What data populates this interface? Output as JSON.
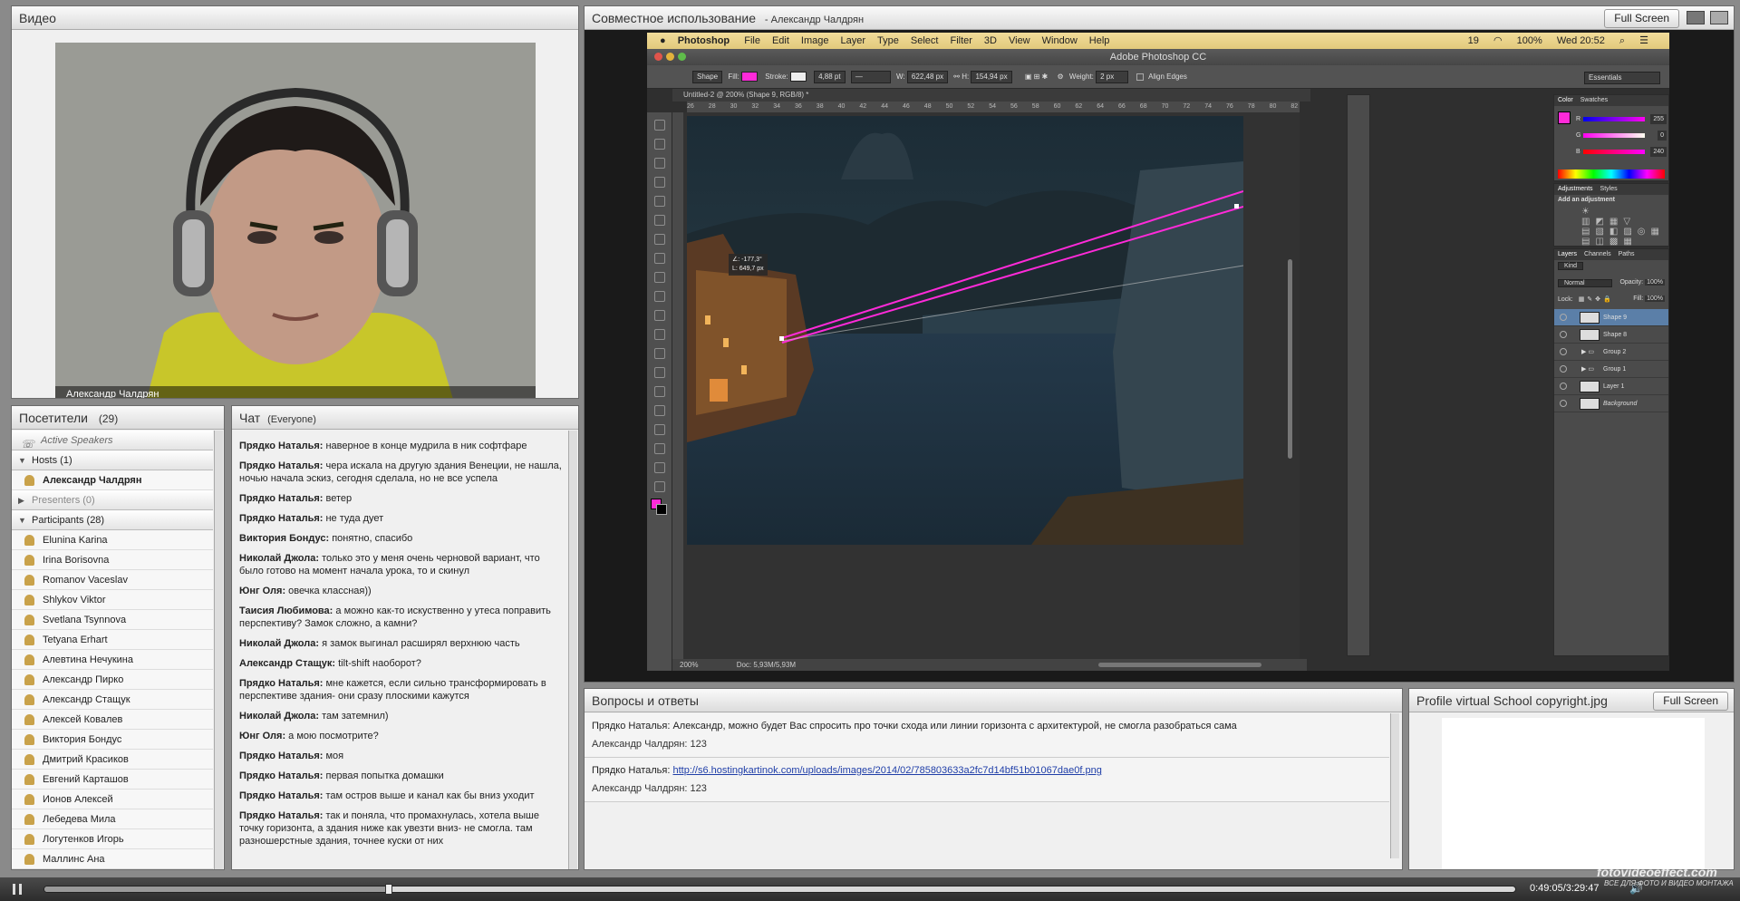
{
  "video_pod": {
    "title": "Видео",
    "speaker_name": "Александр Чалдрян"
  },
  "share_pod": {
    "title": "Совместное использование",
    "presenter": "- Александр Чалдрян",
    "fullscreen_label": "Full Screen"
  },
  "attendees": {
    "title": "Посетители",
    "count": "(29)",
    "active_speakers": "Active Speakers",
    "hosts_label": "Hosts (1)",
    "hosts": [
      "Александр Чалдрян"
    ],
    "presenters_label": "Presenters (0)",
    "participants_label": "Participants (28)",
    "participants": [
      "Elunina Karina",
      "Irina Borisovna",
      "Romanov Vaceslav",
      "Shlykov Viktor",
      "Svetlana Tsynnova",
      "Tetyana Erhart",
      "Алевтина Нечукина",
      "Александр Пирко",
      "Александр Стащук",
      "Алексей Ковалев",
      "Виктория Бондус",
      "Дмитрий Красиков",
      "Евгений Карташов",
      "Ионов Алексей",
      "Лебедева Мила",
      "Логутенков Игорь",
      "Маллинс Ана"
    ]
  },
  "chat": {
    "title": "Чат",
    "scope": "(Everyone)",
    "messages": [
      {
        "author": "Прядко Наталья:",
        "text": "наверное в конце мудрила в ник софтфаре"
      },
      {
        "author": "Прядко Наталья:",
        "text": "чера искала на другую здания Венеции, не нашла, ночью начала эскиз,  сегодня  сделала, но не все успела"
      },
      {
        "author": "Прядко Наталья:",
        "text": "ветер"
      },
      {
        "author": "Прядко Наталья:",
        "text": "не туда дует"
      },
      {
        "author": "Виктория Бондус:",
        "text": "понятно, спасибо"
      },
      {
        "author": "Николай Джола:",
        "text": "только это у меня очень черновой вариант, что было готово на момент начала урока, то и скинул"
      },
      {
        "author": "Юнг Оля:",
        "text": "овечка классная))"
      },
      {
        "author": "Таисия Любимова:",
        "text": "а можно как-то искуственно у утеса поправить перспективу? Замок сложно, а камни?"
      },
      {
        "author": "Николай Джола:",
        "text": "я замок выгинал расширял верхнюю часть"
      },
      {
        "author": "Александр Стащук:",
        "text": "tilt-shift наоборот?"
      },
      {
        "author": "Прядко Наталья:",
        "text": "мне кажется, если сильно трансформировать в перспективе здания- они сразу плоскими кажутся"
      },
      {
        "author": "Николай Джола:",
        "text": "там затемнил)"
      },
      {
        "author": "Юнг Оля:",
        "text": "а мою посмотрите?"
      },
      {
        "author": "Прядко Наталья:",
        "text": "моя"
      },
      {
        "author": "Прядко Наталья:",
        "text": "первая попытка домашки"
      },
      {
        "author": "Прядко Наталья:",
        "text": "там остров выше и канал как бы вниз уходит"
      },
      {
        "author": "Прядко Наталья:",
        "text": "так и поняла, что промахнулась, хотела выше точку горизонта, а здания ниже как увезти вниз- не смогла. там разношерстные здания, точнее куски от них"
      }
    ]
  },
  "photoshop": {
    "apple_menu": [
      ""
    ],
    "app_name": "Photoshop",
    "menu": [
      "File",
      "Edit",
      "Image",
      "Layer",
      "Type",
      "Select",
      "Filter",
      "3D",
      "View",
      "Window",
      "Help"
    ],
    "status_right": {
      "battery": "100%",
      "time": "Wed 20:52",
      "badge": "19"
    },
    "window_title": "Adobe Photoshop CC",
    "options": {
      "shape": "Shape",
      "fill": "Fill:",
      "stroke": "Stroke:",
      "stroke_size": "4,88 pt",
      "w_label": "W:",
      "w": "622,48 px",
      "h_label": "H:",
      "h": "154,94 px",
      "weight_label": "Weight:",
      "weight": "2 px",
      "align": "Align Edges",
      "workspace": "Essentials"
    },
    "doc_tab": "Untitled-2 @ 200% (Shape 9, RGB/8) *",
    "ruler_ticks": [
      "26",
      "28",
      "30",
      "32",
      "34",
      "36",
      "38",
      "40",
      "42",
      "44",
      "46",
      "48",
      "50",
      "52",
      "54",
      "56",
      "58",
      "60",
      "62",
      "64",
      "66",
      "68",
      "70",
      "72",
      "74",
      "76",
      "78",
      "80",
      "82"
    ],
    "tooltip": [
      "∠: -177,3°",
      "L: 649,7 px"
    ],
    "zoom": "200%",
    "doc_size": "Doc: 5,93M/5,93M",
    "color_panel": {
      "tabs": [
        "Color",
        "Swatches"
      ],
      "r": "255",
      "g": "0",
      "b": "240",
      "r_label": "R",
      "g_label": "G",
      "b_label": "B"
    },
    "adjustments": {
      "tabs": [
        "Adjustments",
        "Styles"
      ],
      "add": "Add an adjustment"
    },
    "layers_panel": {
      "tabs": [
        "Layers",
        "Channels",
        "Paths"
      ],
      "kind": "Kind",
      "blend": "Normal",
      "opacity_label": "Opacity:",
      "opacity": "100%",
      "lock_label": "Lock:",
      "fill_label": "Fill:",
      "fill": "100%",
      "layers": [
        "Shape 9",
        "Shape 8",
        "Group 2",
        "Group 1",
        "Layer 1",
        "Background"
      ]
    }
  },
  "qa_pod": {
    "title": "Вопросы и ответы",
    "items": [
      {
        "question_author": "Прядко Наталья:",
        "question": "Александр, можно будет Вас спросить про точки схода или линии горизонта с архитектурой, не смогла разобраться сама",
        "answer": "Александр Чалдрян: 123"
      },
      {
        "question_author": "Прядко Наталья:",
        "question": "http://s6.hostingkartinok.com/uploads/images/2014/02/785803633a2fc7d14bf51b01067dae0f.png",
        "answer": "Александр Чалдрян: 123"
      }
    ]
  },
  "file_pod": {
    "title": "Profile virtual School copyright.jpg",
    "fullscreen_label": "Full Screen"
  },
  "player": {
    "time": "0:49:05/3:29:47",
    "progress": 0.234,
    "watermark": "fotovideoeffect.com",
    "watermark_sub": "ВСЕ ДЛЯ ФОТО И ВИДЕО МОНТАЖА"
  },
  "colors": {
    "accent_magenta": "#ff2ad9",
    "layer_selected": "#5b7fa8"
  }
}
